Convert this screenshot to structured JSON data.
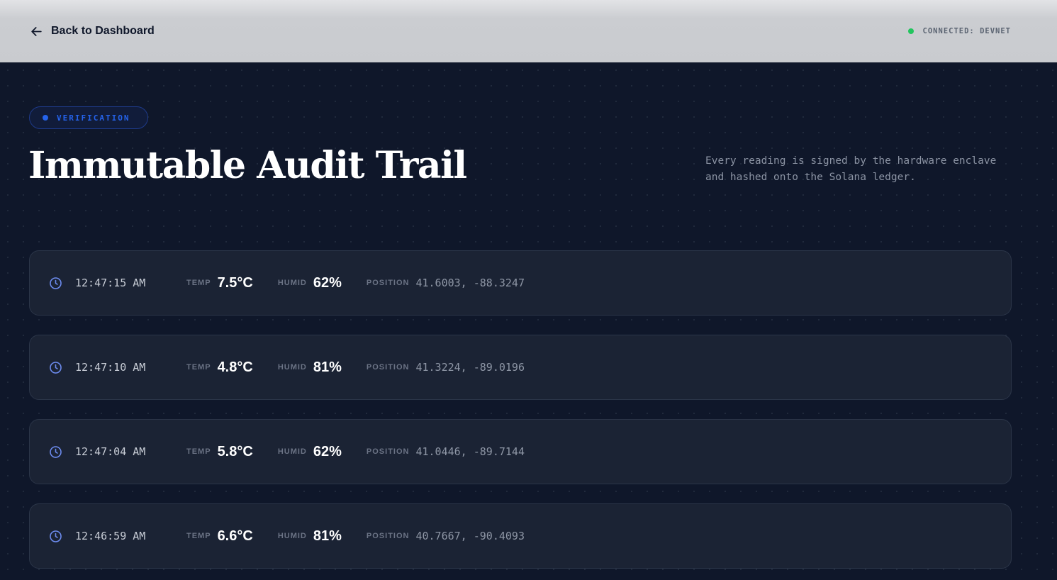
{
  "topbar": {
    "back_label": "Back to Dashboard",
    "status_label": "CONNECTED: DEVNET",
    "status_color": "#22c55e"
  },
  "hero": {
    "badge": "VERIFICATION",
    "title": "Immutable Audit Trail",
    "subtitle": "Every reading is signed by the hardware enclave and hashed onto the Solana ledger."
  },
  "labels": {
    "temp": "TEMP",
    "humid": "HUMID",
    "position": "POSITION"
  },
  "readings": [
    {
      "time": "12:47:15 AM",
      "temp": "7.5°C",
      "humid": "62%",
      "position": "41.6003, -88.3247"
    },
    {
      "time": "12:47:10 AM",
      "temp": "4.8°C",
      "humid": "81%",
      "position": "41.3224, -89.0196"
    },
    {
      "time": "12:47:04 AM",
      "temp": "5.8°C",
      "humid": "62%",
      "position": "41.0446, -89.7144"
    },
    {
      "time": "12:46:59 AM",
      "temp": "6.6°C",
      "humid": "81%",
      "position": "40.7667, -90.4093"
    }
  ],
  "colors": {
    "accent": "#2563eb",
    "clock": "#6d8cf0",
    "background": "#0f172a"
  }
}
